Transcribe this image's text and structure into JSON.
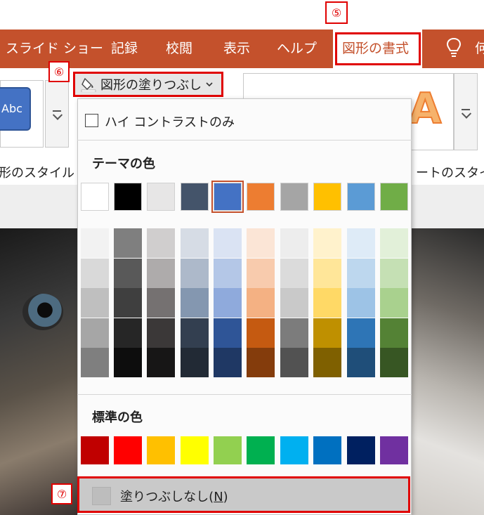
{
  "annotations": {
    "five": "⑤",
    "six": "⑥",
    "seven": "⑦"
  },
  "ribbon_tabs": [
    {
      "label": "スライド ショー"
    },
    {
      "label": "記録"
    },
    {
      "label": "校閲"
    },
    {
      "label": "表示"
    },
    {
      "label": "ヘルプ"
    },
    {
      "label": "図形の書式"
    },
    {
      "label": "何"
    }
  ],
  "ribbon": {
    "shape_style_sample": "Abc",
    "shape_style_group": "形のスタイル",
    "fill_button": "図形の塗りつぶし",
    "wordart_sample": "A",
    "wordart_group": "ートのスタイル"
  },
  "dropdown": {
    "high_contrast": "ハイ コントラストのみ",
    "theme_colors_heading": "テーマの色",
    "standard_colors_heading": "標準の色",
    "no_fill_label": "塗りつぶしなし(",
    "no_fill_key": "N",
    "no_fill_close": ")"
  },
  "theme_colors": [
    "#ffffff",
    "#000000",
    "#e7e6e6",
    "#44546a",
    "#4472c4",
    "#ed7d31",
    "#a5a5a5",
    "#ffc000",
    "#5b9bd5",
    "#70ad47"
  ],
  "theme_selected_index": 4,
  "theme_shades": [
    [
      "#f2f2f2",
      "#d9d9d9",
      "#bfbfbf",
      "#a6a6a6",
      "#7f7f7f"
    ],
    [
      "#7f7f7f",
      "#595959",
      "#3f3f3f",
      "#262626",
      "#0d0d0d"
    ],
    [
      "#d0cece",
      "#aeabab",
      "#757171",
      "#3b3838",
      "#171616"
    ],
    [
      "#d6dce5",
      "#adb9ca",
      "#8497b0",
      "#333f50",
      "#222a35"
    ],
    [
      "#dae3f3",
      "#b4c7e7",
      "#8faadc",
      "#2f5597",
      "#1f3864"
    ],
    [
      "#fbe5d6",
      "#f8cbad",
      "#f4b183",
      "#c55a11",
      "#843c0c"
    ],
    [
      "#ededed",
      "#dbdbdb",
      "#c9c9c9",
      "#7c7c7c",
      "#525252"
    ],
    [
      "#fff2cc",
      "#ffe699",
      "#ffd966",
      "#bf9000",
      "#7f6000"
    ],
    [
      "#deebf7",
      "#bdd7ee",
      "#9dc3e6",
      "#2e75b6",
      "#1f4e79"
    ],
    [
      "#e2f0d9",
      "#c5e0b4",
      "#a9d18e",
      "#548235",
      "#375623"
    ]
  ],
  "standard_colors": [
    "#c00000",
    "#ff0000",
    "#ffc000",
    "#ffff00",
    "#92d050",
    "#00b050",
    "#00b0f0",
    "#0070c0",
    "#002060",
    "#7030a0"
  ]
}
